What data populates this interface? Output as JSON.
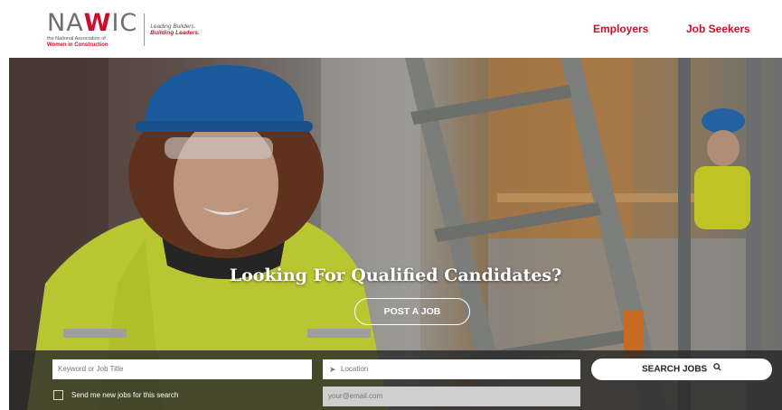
{
  "logo": {
    "wordmark_start": "NA",
    "wordmark_w": "W",
    "wordmark_end": "IC",
    "sub1": "the National Association of",
    "sub2": "Women in Construction",
    "tag1": "Leading Builders.",
    "tag2": "Building Leaders."
  },
  "nav": {
    "employers": "Employers",
    "job_seekers": "Job Seekers"
  },
  "hero": {
    "title": "Looking For Qualified Candidates?",
    "post_button": "POST A JOB"
  },
  "search": {
    "keyword_placeholder": "Keyword or Job Title",
    "location_placeholder": "Location",
    "search_button": "SEARCH JOBS",
    "checkbox_label": "Send me new jobs for this search",
    "email_placeholder": "your@email.com"
  },
  "colors": {
    "brand_red": "#c8102e",
    "overlay": "#282828"
  },
  "icons": {
    "location": "location-arrow-icon",
    "search": "magnifier-icon"
  }
}
